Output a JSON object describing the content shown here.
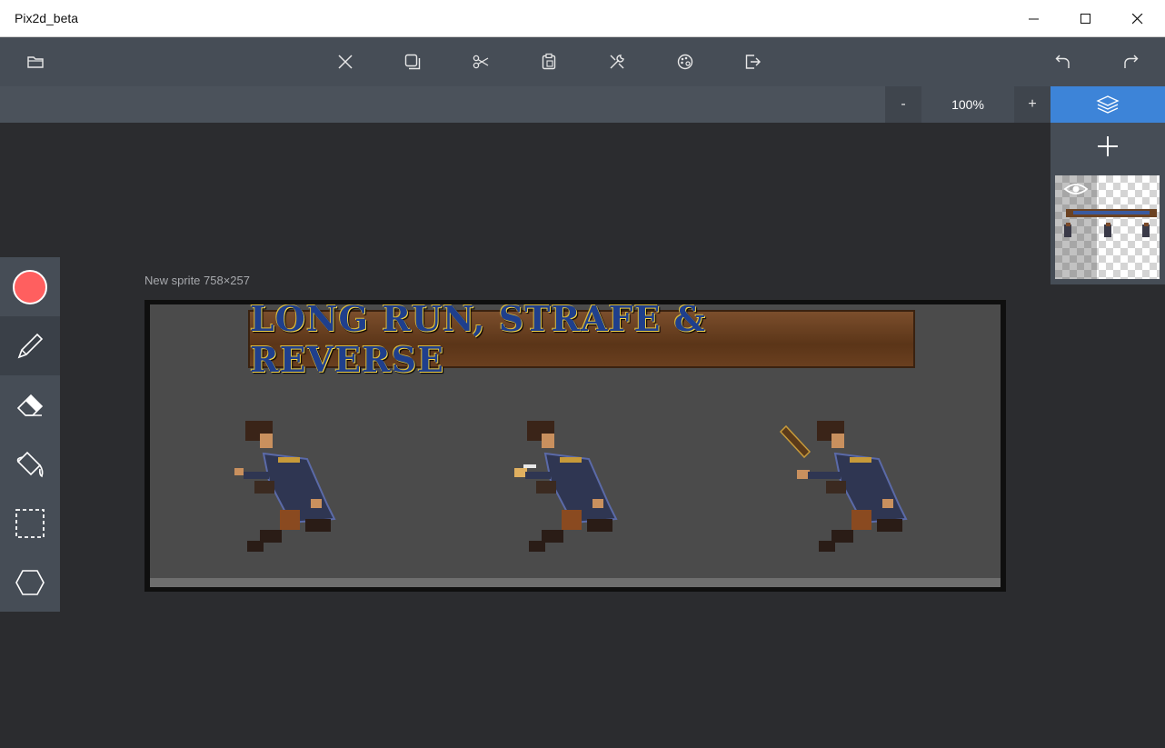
{
  "window": {
    "title": "Pix2d_beta"
  },
  "zoom": {
    "minus": "-",
    "value": "100%",
    "plus": "+"
  },
  "sprite": {
    "label": "New sprite 758×257",
    "banner_text": "LONG RUN,  STRAFE  &  REVERSE"
  },
  "colors": {
    "primary": "#ff5f5f",
    "accent": "#3d84d8",
    "toolbar": "#464d56",
    "background": "#2b2c2f"
  },
  "toolbar_icons": [
    "folder-icon",
    "close-icon",
    "duplicate-icon",
    "cut-icon",
    "paste-icon",
    "tools-icon",
    "palette-icon",
    "export-icon",
    "undo-icon",
    "redo-icon"
  ],
  "tools": [
    "color-picker",
    "pencil",
    "eraser",
    "fill-bucket",
    "rect-select",
    "polygon-select"
  ]
}
